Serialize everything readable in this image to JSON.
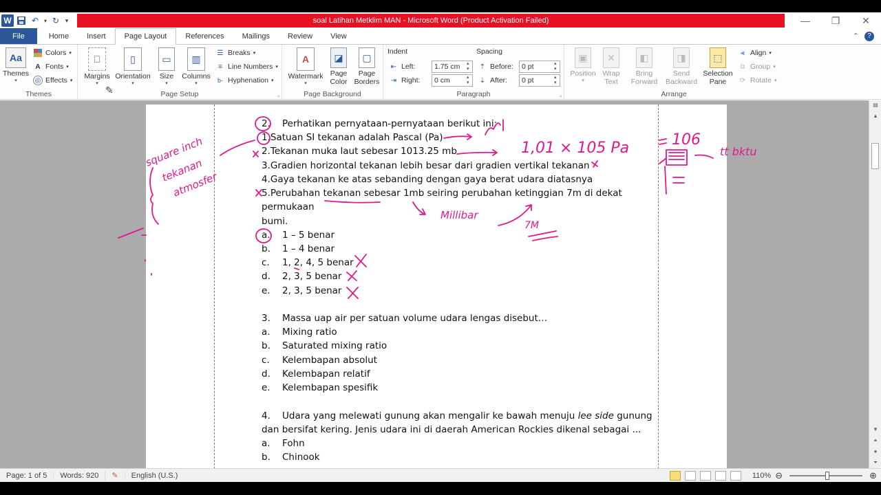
{
  "window": {
    "title": "soal Latihan Metklim MAN  -  Microsoft Word (Product Activation Failed)",
    "app_icon": "W"
  },
  "tabs": [
    "File",
    "Home",
    "Insert",
    "Page Layout",
    "References",
    "Mailings",
    "Review",
    "View"
  ],
  "active_tab": "Page Layout",
  "ribbon": {
    "themes": {
      "themes_label": "Themes",
      "colors_label": "Colors",
      "fonts_label": "Fonts",
      "effects_label": "Effects",
      "group_label": "Themes"
    },
    "page_setup": {
      "margins": "Margins",
      "orientation": "Orientation",
      "size": "Size",
      "columns": "Columns",
      "breaks": "Breaks",
      "line_numbers": "Line Numbers",
      "hyphenation": "Hyphenation",
      "group_label": "Page Setup"
    },
    "page_background": {
      "watermark": "Watermark",
      "page_color_1": "Page",
      "page_color_2": "Color",
      "page_borders_1": "Page",
      "page_borders_2": "Borders",
      "group_label": "Page Background"
    },
    "paragraph": {
      "indent_title": "Indent",
      "left_label": "Left:",
      "left_value": "1.75 cm",
      "right_label": "Right:",
      "right_value": "0 cm",
      "spacing_title": "Spacing",
      "before_label": "Before:",
      "before_value": "0 pt",
      "after_label": "After:",
      "after_value": "0 pt",
      "group_label": "Paragraph"
    },
    "arrange": {
      "position": "Position",
      "wrap_1": "Wrap",
      "wrap_2": "Text",
      "bring_1": "Bring",
      "bring_2": "Forward",
      "send_1": "Send",
      "send_2": "Backward",
      "selection_1": "Selection",
      "selection_2": "Pane",
      "align": "Align",
      "group": "Group",
      "rotate": "Rotate",
      "group_label": "Arrange"
    }
  },
  "document": {
    "q2": {
      "num": "2.",
      "text": "Perhatikan pernyataan-pernyataan berikut ini:",
      "statements": [
        "1.Satuan SI tekanan adalah Pascal (Pa)",
        "2.Tekanan muka laut sebesar 1013.25 mb",
        "3.Gradien horizontal tekanan lebih besar dari gradien vertikal tekanan",
        "4.Gaya tekanan ke atas sebanding dengan gaya berat udara diatasnya",
        "5.Perubahan tekanan sebesar 1mb seiring perubahan ketinggian 7m di dekat",
        "permukaan",
        "bumi."
      ],
      "options": [
        {
          "label": "a.",
          "text": "1 – 5 benar"
        },
        {
          "label": "b.",
          "text": "1 – 4 benar"
        },
        {
          "label": "c.",
          "text": "1, 2, 4, 5 benar"
        },
        {
          "label": "d.",
          "text": "2, 3, 5 benar"
        },
        {
          "label": "e.",
          "text": "2, 3, 5 benar"
        }
      ]
    },
    "q3": {
      "num": "3.",
      "text": "Massa uap air per satuan volume udara lengas disebut…",
      "options": [
        {
          "label": "a.",
          "text": "Mixing ratio"
        },
        {
          "label": "b.",
          "text": "Saturated mixing ratio"
        },
        {
          "label": "c.",
          "text": "Kelembapan absolut"
        },
        {
          "label": "d.",
          "text": "Kelembapan relatif"
        },
        {
          "label": "e.",
          "text": "Kelembapan spesifik"
        }
      ]
    },
    "q4": {
      "num": "4.",
      "text_pre": "Udara yang melewati gunung akan mengalir ke bawah menuju ",
      "text_italic": "lee side",
      "text_post": " gunung",
      "line2": "dan bersifat kering. Jenis udara ini di daerah American Rockies dikenal sebagai ...",
      "options": [
        {
          "label": "a.",
          "text": "Fohn"
        },
        {
          "label": "b.",
          "text": "Chinook"
        }
      ]
    }
  },
  "status": {
    "page": "Page: 1 of 5",
    "words": "Words: 920",
    "language": "English (U.S.)",
    "zoom": "110%"
  }
}
